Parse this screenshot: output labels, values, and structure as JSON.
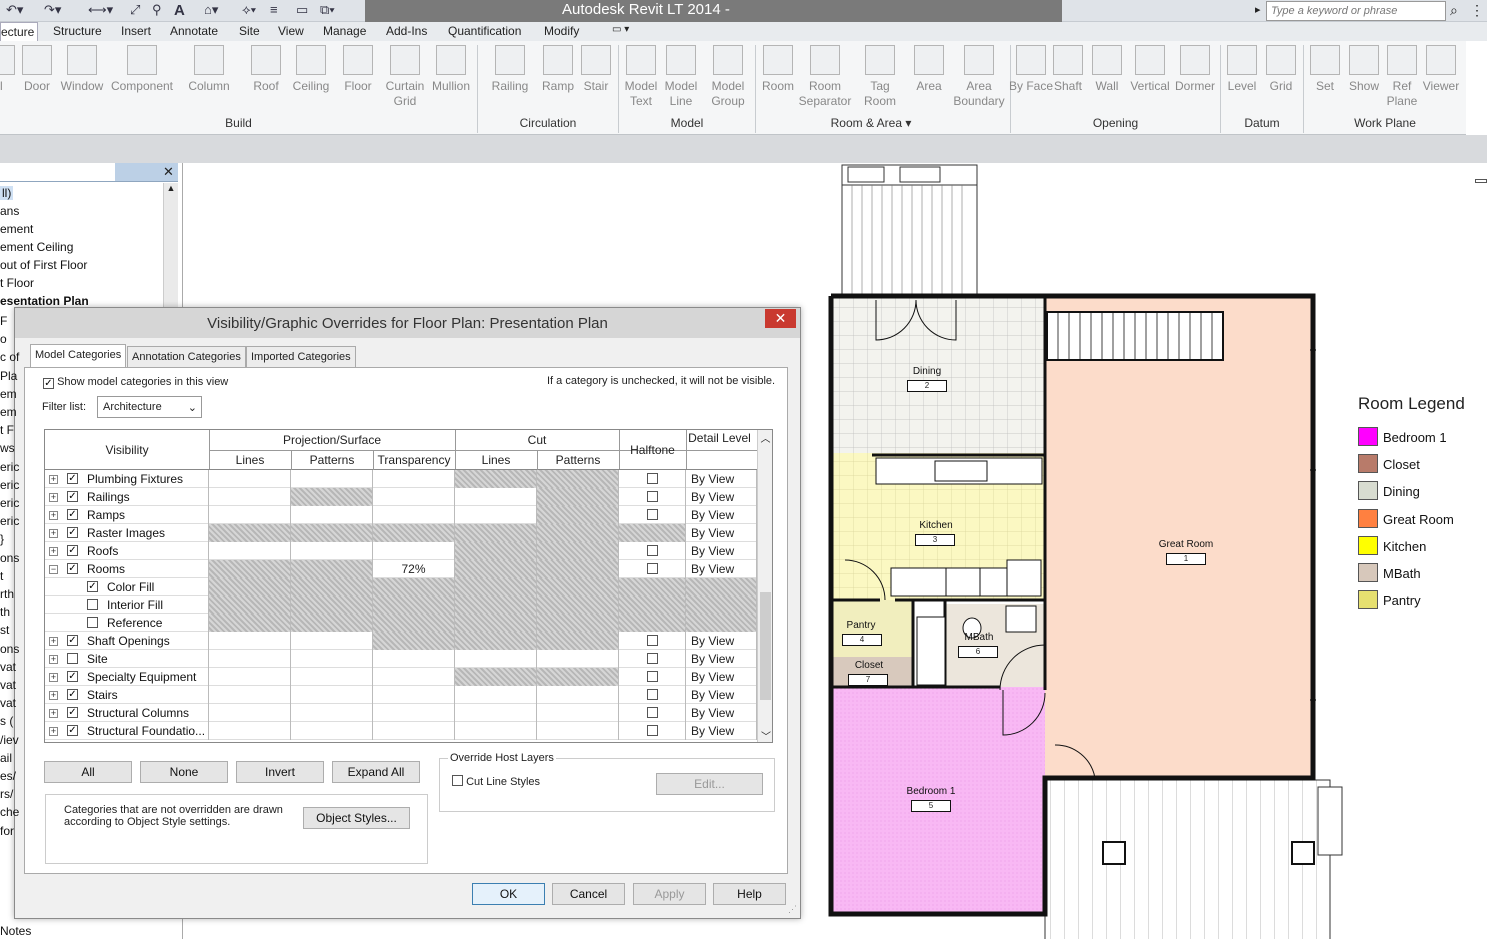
{
  "app": {
    "title": "Autodesk Revit LT 2014 -",
    "search_placeholder": "Type a keyword or phrase"
  },
  "menu": [
    "ecture",
    "Structure",
    "Insert",
    "Annotate",
    "Site",
    "View",
    "Manage",
    "Add-Ins",
    "Quantification",
    "Modify"
  ],
  "ribbon": {
    "build": [
      "ll",
      "Door",
      "Window",
      "Component",
      "Column",
      "Roof",
      "Ceiling",
      "Floor",
      "Curtain Grid",
      "Mullion"
    ],
    "circulation": [
      "Railing",
      "Ramp",
      "Stair"
    ],
    "model": [
      "Model Text",
      "Model Line",
      "Model Group"
    ],
    "room_area": [
      "Room",
      "Room Separator",
      "Tag Room",
      "Area",
      "Area Boundary"
    ],
    "opening": [
      "By Face",
      "Shaft",
      "Wall",
      "Vertical",
      "Dormer"
    ],
    "datum": [
      "Level",
      "Grid"
    ],
    "workplane": [
      "Set",
      "Show",
      "Ref Plane",
      "Viewer"
    ],
    "panels": [
      "Build",
      "Circulation",
      "Model",
      "Room & Area",
      "Opening",
      "Datum",
      "Work Plane"
    ]
  },
  "browser": {
    "items": [
      "ll)",
      "ans",
      "ement",
      "ement Ceiling",
      "out of First Floor",
      "t Floor",
      "esentation Plan"
    ],
    "cut_items": [
      "F",
      "o",
      "c of",
      "Pla",
      "em",
      "em",
      "t F",
      "ws",
      "eric",
      "eric",
      "eric",
      "eric",
      "}",
      "ons",
      "t",
      "rth",
      "th",
      "st",
      "ons",
      "vat",
      "vat",
      "vat",
      "s (",
      "/iev",
      "ail",
      "es/",
      "rs/",
      "che",
      "for"
    ],
    "bottom": "Notes"
  },
  "dialog": {
    "title": "Visibility/Graphic Overrides for Floor Plan: Presentation Plan",
    "tabs": [
      "Model Categories",
      "Annotation Categories",
      "Imported Categories"
    ],
    "show_label": "Show model categories in this view",
    "hint": "If a category is unchecked, it will not be visible.",
    "filter_label": "Filter list:",
    "filter_value": "Architecture",
    "headers": {
      "visibility": "Visibility",
      "proj": "Projection/Surface",
      "cut": "Cut",
      "halftone": "Halftone",
      "detail": "Detail Level",
      "lines": "Lines",
      "patterns": "Patterns",
      "transparency": "Transparency",
      "cut_lines": "Lines",
      "cut_patterns": "Patterns"
    },
    "rows": [
      {
        "name": "Plumbing Fixtures",
        "checked": true,
        "detail": "By View"
      },
      {
        "name": "Railings",
        "checked": true,
        "detail": "By View"
      },
      {
        "name": "Ramps",
        "checked": true,
        "detail": "By View"
      },
      {
        "name": "Raster Images",
        "checked": true,
        "detail": "By View"
      },
      {
        "name": "Roofs",
        "checked": true,
        "detail": "By View"
      },
      {
        "name": "Rooms",
        "checked": true,
        "detail": "By View",
        "transparency": "72%"
      },
      {
        "name": "Color Fill",
        "checked": true,
        "detail": ""
      },
      {
        "name": "Interior Fill",
        "checked": false,
        "detail": ""
      },
      {
        "name": "Reference",
        "checked": false,
        "detail": ""
      },
      {
        "name": "Shaft Openings",
        "checked": true,
        "detail": "By View"
      },
      {
        "name": "Site",
        "checked": false,
        "detail": "By View"
      },
      {
        "name": "Specialty Equipment",
        "checked": true,
        "detail": "By View"
      },
      {
        "name": "Stairs",
        "checked": true,
        "detail": "By View"
      },
      {
        "name": "Structural Columns",
        "checked": true,
        "detail": "By View"
      },
      {
        "name": "Structural Foundatio...",
        "checked": true,
        "detail": "By View"
      }
    ],
    "buttons": {
      "all": "All",
      "none": "None",
      "invert": "Invert",
      "expand": "Expand All",
      "object_styles": "Object Styles...",
      "edit": "Edit...",
      "ok": "OK",
      "cancel": "Cancel",
      "apply": "Apply",
      "help": "Help"
    },
    "note": "Categories that are not overridden are drawn according to Object Style settings.",
    "override_host": "Override Host Layers",
    "cut_line_styles": "Cut Line Styles"
  },
  "plan": {
    "rooms": [
      {
        "name": "Dining",
        "num": "2"
      },
      {
        "name": "Kitchen",
        "num": "3"
      },
      {
        "name": "Great Room",
        "num": "1"
      },
      {
        "name": "Pantry",
        "num": "4"
      },
      {
        "name": "MBath",
        "num": "6"
      },
      {
        "name": "Closet",
        "num": "7"
      },
      {
        "name": "Bedroom 1",
        "num": "5"
      }
    ]
  },
  "legend": {
    "title": "Room Legend",
    "items": [
      {
        "name": "Bedroom 1",
        "color": "#ff00ff"
      },
      {
        "name": "Closet",
        "color": "#b87b6a"
      },
      {
        "name": "Dining",
        "color": "#d8dcd0"
      },
      {
        "name": "Great Room",
        "color": "#ff8040"
      },
      {
        "name": "Kitchen",
        "color": "#ffff00"
      },
      {
        "name": "MBath",
        "color": "#d7c8bb"
      },
      {
        "name": "Pantry",
        "color": "#e6e070"
      }
    ]
  }
}
